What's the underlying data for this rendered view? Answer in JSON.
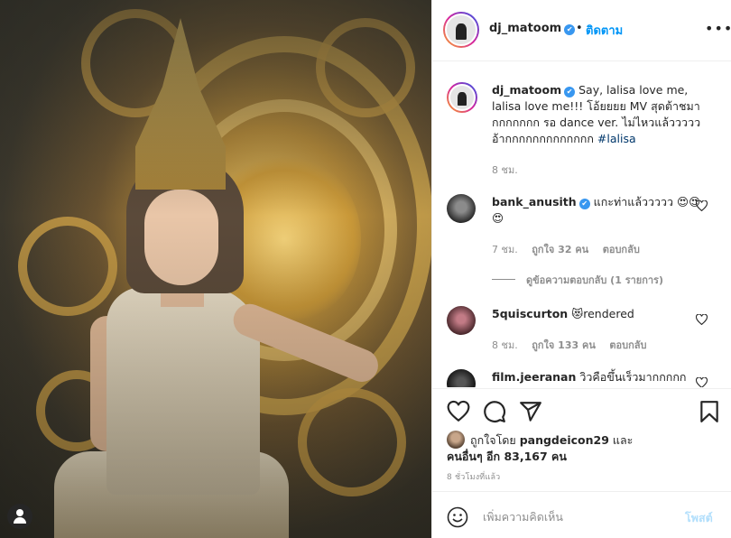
{
  "post": {
    "author": "dj_matoom",
    "verified_mark": "✔",
    "separator": "•",
    "follow_label": "ติดตาม",
    "more_label": "•••"
  },
  "caption": {
    "username": "dj_matoom",
    "text": " Say, lalisa love me, lalisa love me!!! โอ้ยยยย MV สุดต้าชมา กกกกกกก รอ dance ver. ไม่ไหวแล้ววววว อ้ากกกกกกกกกกกกก ",
    "hashtag": "#lalisa",
    "time": "8 ชม."
  },
  "comments": [
    {
      "username": "bank_anusith",
      "text": " แกะท่าแล้ววววว 😍😍😍",
      "time": "7 ชม.",
      "likes": "ถูกใจ 32 คน",
      "reply": "ตอบกลับ",
      "view_replies": "ดูข้อความตอบกลับ (1 รายการ)"
    },
    {
      "username": "5quiscurton",
      "text": " 😻rendered",
      "time": "8 ชม.",
      "likes": "ถูกใจ 133 คน",
      "reply": "ตอบกลับ"
    },
    {
      "username": "film.jeeranan",
      "text": " วิวคือขึ้นเร็วมากกกกก"
    }
  ],
  "likes": {
    "prefix": "ถูกใจโดย ",
    "user": "pangdeicon29",
    "middle": " และ",
    "others": "คนอื่นๆ อีก 83,167 คน"
  },
  "time_ago": "8 ชั่วโมงที่แล้ว",
  "comment_box": {
    "placeholder": "เพิ่มความคิดเห็น",
    "post_label": "โพสต์"
  },
  "icons": [
    "heart-icon",
    "comment-icon",
    "share-icon",
    "bookmark-icon",
    "smile-icon",
    "user-icon"
  ]
}
